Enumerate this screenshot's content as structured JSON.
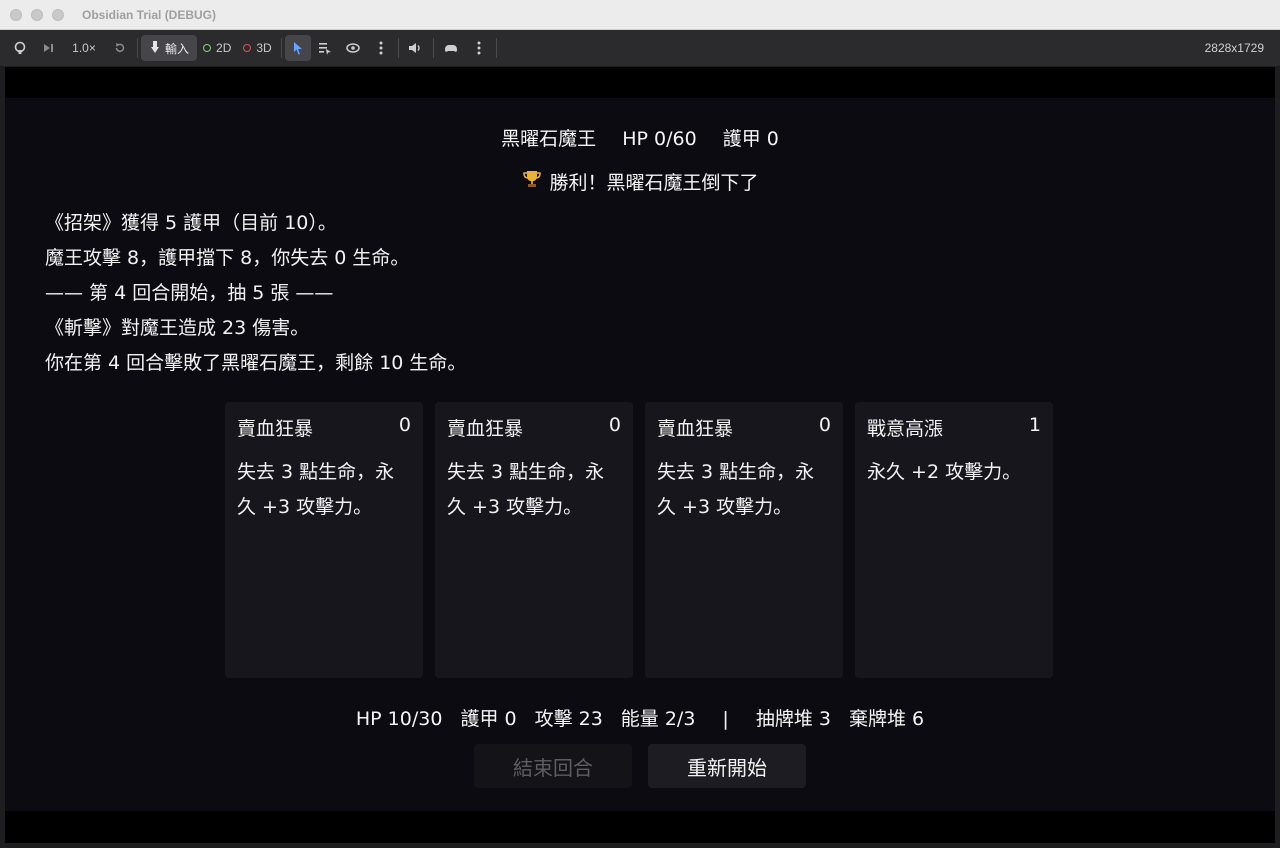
{
  "window": {
    "title": "Obsidian Trial (DEBUG)"
  },
  "toolbar": {
    "speed": "1.0×",
    "input_label": "輸入",
    "mode_2d": "2D",
    "mode_3d": "3D",
    "resolution": "2828x1729",
    "colors": {
      "accent": "#6aa3ff",
      "mode_2d": "#7fd17a",
      "mode_3d": "#e0524e"
    },
    "icons": [
      "remote-debug-icon",
      "step-icon",
      "reset-icon",
      "input-icon",
      "select-icon",
      "list-icon",
      "eye-icon",
      "more-icon",
      "speaker-icon",
      "gamepad-icon"
    ]
  },
  "enemy": {
    "name": "黑曜石魔王",
    "hp": "HP 0/60",
    "armor": "護甲 0"
  },
  "victory": {
    "icon": "trophy-icon",
    "text": "勝利！黑曜石魔王倒下了"
  },
  "log": [
    "《招架》獲得 5 護甲（目前 10）。",
    "魔王攻擊 8，護甲擋下 8，你失去 0 生命。",
    "—— 第 4 回合開始，抽 5 張 ——",
    "《斬擊》對魔王造成 23 傷害。",
    "你在第 4 回合擊敗了黑曜石魔王，剩餘 10 生命。"
  ],
  "hand": [
    {
      "name": "賣血狂暴",
      "cost": "0",
      "desc": "失去 3 點生命，永久 +3 攻擊力。"
    },
    {
      "name": "賣血狂暴",
      "cost": "0",
      "desc": "失去 3 點生命，永久 +3 攻擊力。"
    },
    {
      "name": "賣血狂暴",
      "cost": "0",
      "desc": "失去 3 點生命，永久 +3 攻擊力。"
    },
    {
      "name": "戰意高漲",
      "cost": "1",
      "desc": "永久 +2 攻擊力。"
    }
  ],
  "player": {
    "hp": "HP 10/30",
    "armor": "護甲 0",
    "attack": "攻擊 23",
    "energy": "能量 2/3",
    "divider": "|",
    "draw_pile": "抽牌堆 3",
    "discard_pile": "棄牌堆 6"
  },
  "buttons": {
    "end_turn": "結束回合",
    "restart": "重新開始"
  }
}
